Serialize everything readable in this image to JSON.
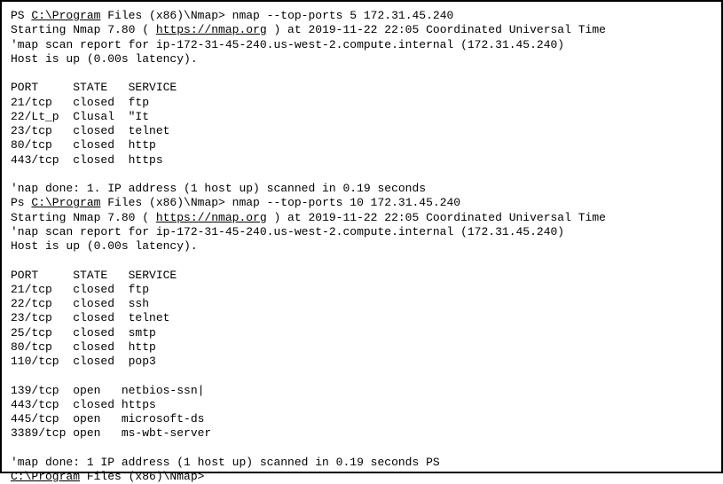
{
  "scan1": {
    "prompt_ps": "PS ",
    "prompt_path": "C:\\Program",
    "prompt_rest": " Files (x86)\\Nmap> ",
    "command": "nmap --top-ports 5 172.31.45.240",
    "starting_pre": "Starting Nmap 7.80 ( ",
    "starting_url": "https://nmap.org",
    "starting_post": " ) at 2019-11-22 22:05 Coordinated Universal Time",
    "report": "'map scan report for ip-172-31-45-240.us-west-2.compute.internal (172.31.45.240)",
    "hostup": "Host is up (0.00s latency).",
    "header": "PORT     STATE   SERVICE",
    "rows": [
      "21/tcp   closed  ftp",
      "22/Lt_p  Clusal  \"It",
      "23/tcp   closed  telnet",
      "80/tcp   closed  http",
      "443/tcp  closed  https"
    ],
    "done": "'nap done: 1. IP address (1 host up) scanned in 0.19 seconds"
  },
  "scan2": {
    "prompt_ps": "Ps ",
    "prompt_path": "C:\\Program",
    "prompt_rest": " Files (x86)\\Nmap> ",
    "command": "nmap --top-ports 10 172.31.45.240",
    "starting_pre": "Starting Nmap 7.80 ( ",
    "starting_url": "https://nmap.org",
    "starting_post": " ) at 2019-11-22 22:05 Coordinated Universal Time",
    "report": "'nap scan report for ip-172-31-45-240.us-west-2.compute.internal (172.31.45.240)",
    "hostup": "Host is up (0.00s latency).",
    "header": "PORT     STATE   SERVICE",
    "rows_a": [
      "21/tcp   closed  ftp",
      "22/tcp   closed  ssh",
      "23/tcp   closed  telnet",
      "25/tcp   closed  smtp",
      "80/tcp   closed  http",
      "110/tcp  closed  pop3"
    ],
    "rows_b": [
      "139/tcp  open   netbios-ssn|",
      "443/tcp  closed https",
      "445/tcp  open   microsoft-ds",
      "3389/tcp open   ms-wbt-server"
    ],
    "done": "'map done: 1 IP address (1 host up) scanned in 0.19 seconds PS"
  },
  "final_prompt": {
    "path": "C:\\Program",
    "rest": " Files (x86)\\Nmap>"
  }
}
